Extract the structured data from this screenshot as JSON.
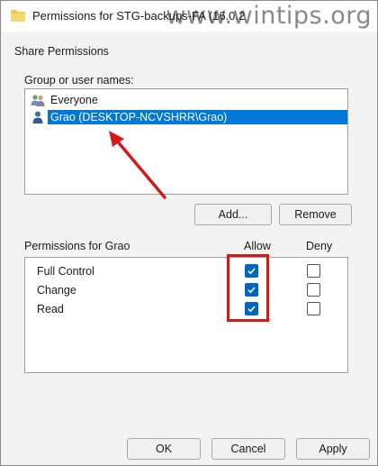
{
  "window": {
    "title": "Permissions for STG-backups-FA (16.0.2",
    "watermark": "www.wintips.org"
  },
  "tab": {
    "label": "Share Permissions"
  },
  "group": {
    "label": "Group or user names:",
    "items": [
      {
        "label": "Everyone",
        "icon": "users-group-icon",
        "selected": false
      },
      {
        "label": "Grao (DESKTOP-NCVSHRR\\Grao)",
        "icon": "user-icon",
        "selected": true
      }
    ],
    "add_label": "Add...",
    "remove_label": "Remove"
  },
  "permissions": {
    "header": "Permissions for Grao",
    "allow_label": "Allow",
    "deny_label": "Deny",
    "rows": [
      {
        "label": "Full Control",
        "allow": true,
        "deny": false
      },
      {
        "label": "Change",
        "allow": true,
        "deny": false
      },
      {
        "label": "Read",
        "allow": true,
        "deny": false
      }
    ]
  },
  "footer": {
    "ok_label": "OK",
    "cancel_label": "Cancel",
    "apply_label": "Apply"
  },
  "colors": {
    "accent": "#0067c0",
    "selection": "#0078d7",
    "annotation": "#d11a1a"
  }
}
